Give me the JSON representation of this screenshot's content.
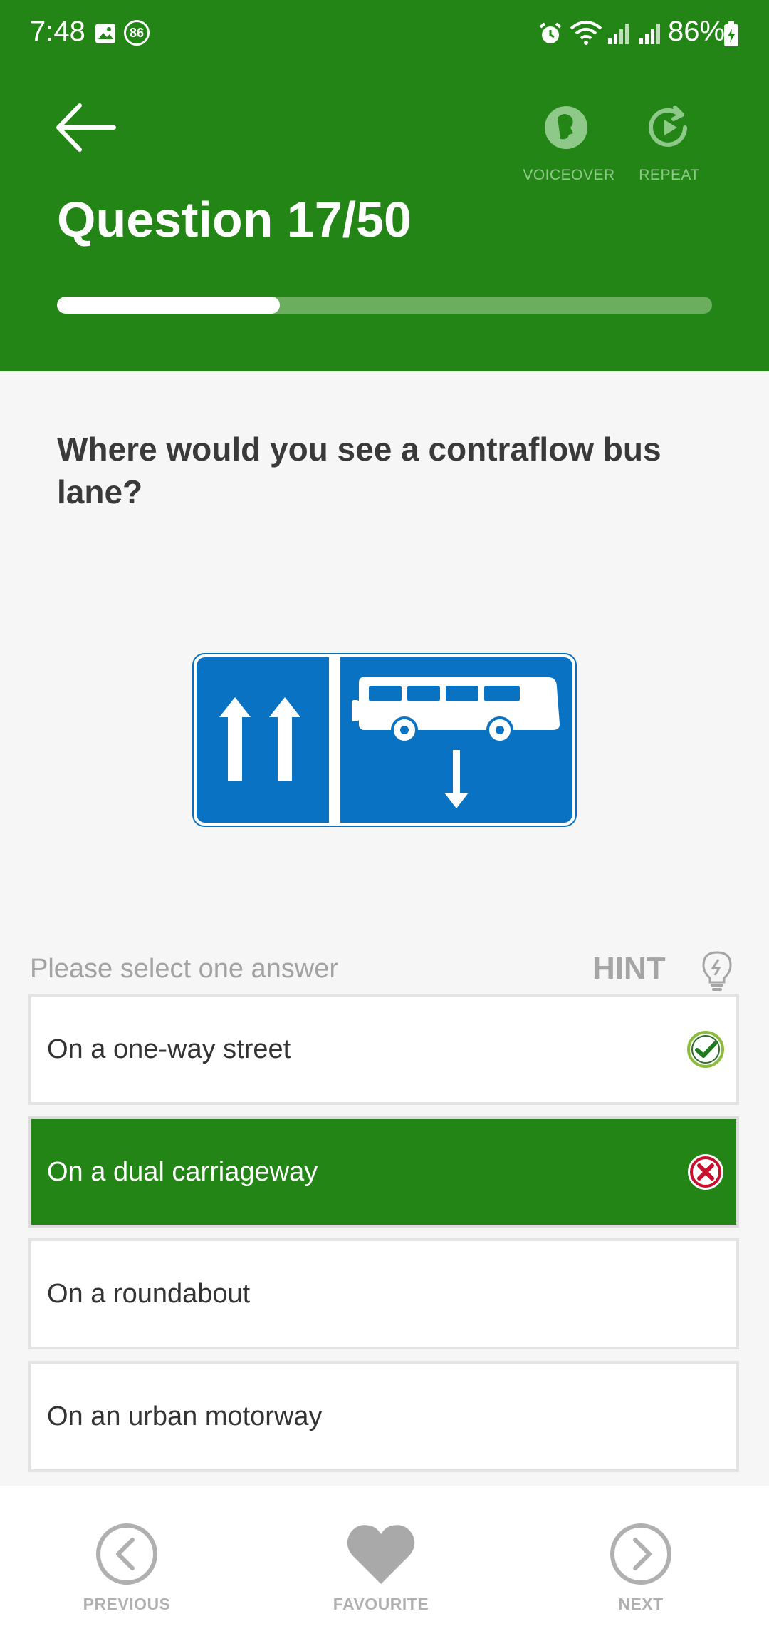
{
  "status_bar": {
    "time": "7:48",
    "notification_badge": "86",
    "battery": "86%"
  },
  "header": {
    "voiceover_label": "VOICEOVER",
    "repeat_label": "REPEAT",
    "title": "Question 17/50",
    "progress": 0.34,
    "colors": {
      "header_bg": "#238516",
      "icon_muted": "#8fc98a"
    }
  },
  "question": {
    "text": "Where would you see a contraflow bus lane?",
    "image_icon": "contraflow-bus-lane-sign"
  },
  "answers": {
    "instruction": "Please select one answer",
    "hint_label": "HINT",
    "options": [
      {
        "label": "On a one-way street",
        "state": "correct"
      },
      {
        "label": "On a dual carriageway",
        "state": "wrong-selected"
      },
      {
        "label": "On a roundabout",
        "state": "none"
      },
      {
        "label": "On an urban motorway",
        "state": "none"
      }
    ]
  },
  "bottom_nav": {
    "previous_label": "PREVIOUS",
    "favourite_label": "FAVOURITE",
    "next_label": "NEXT"
  }
}
